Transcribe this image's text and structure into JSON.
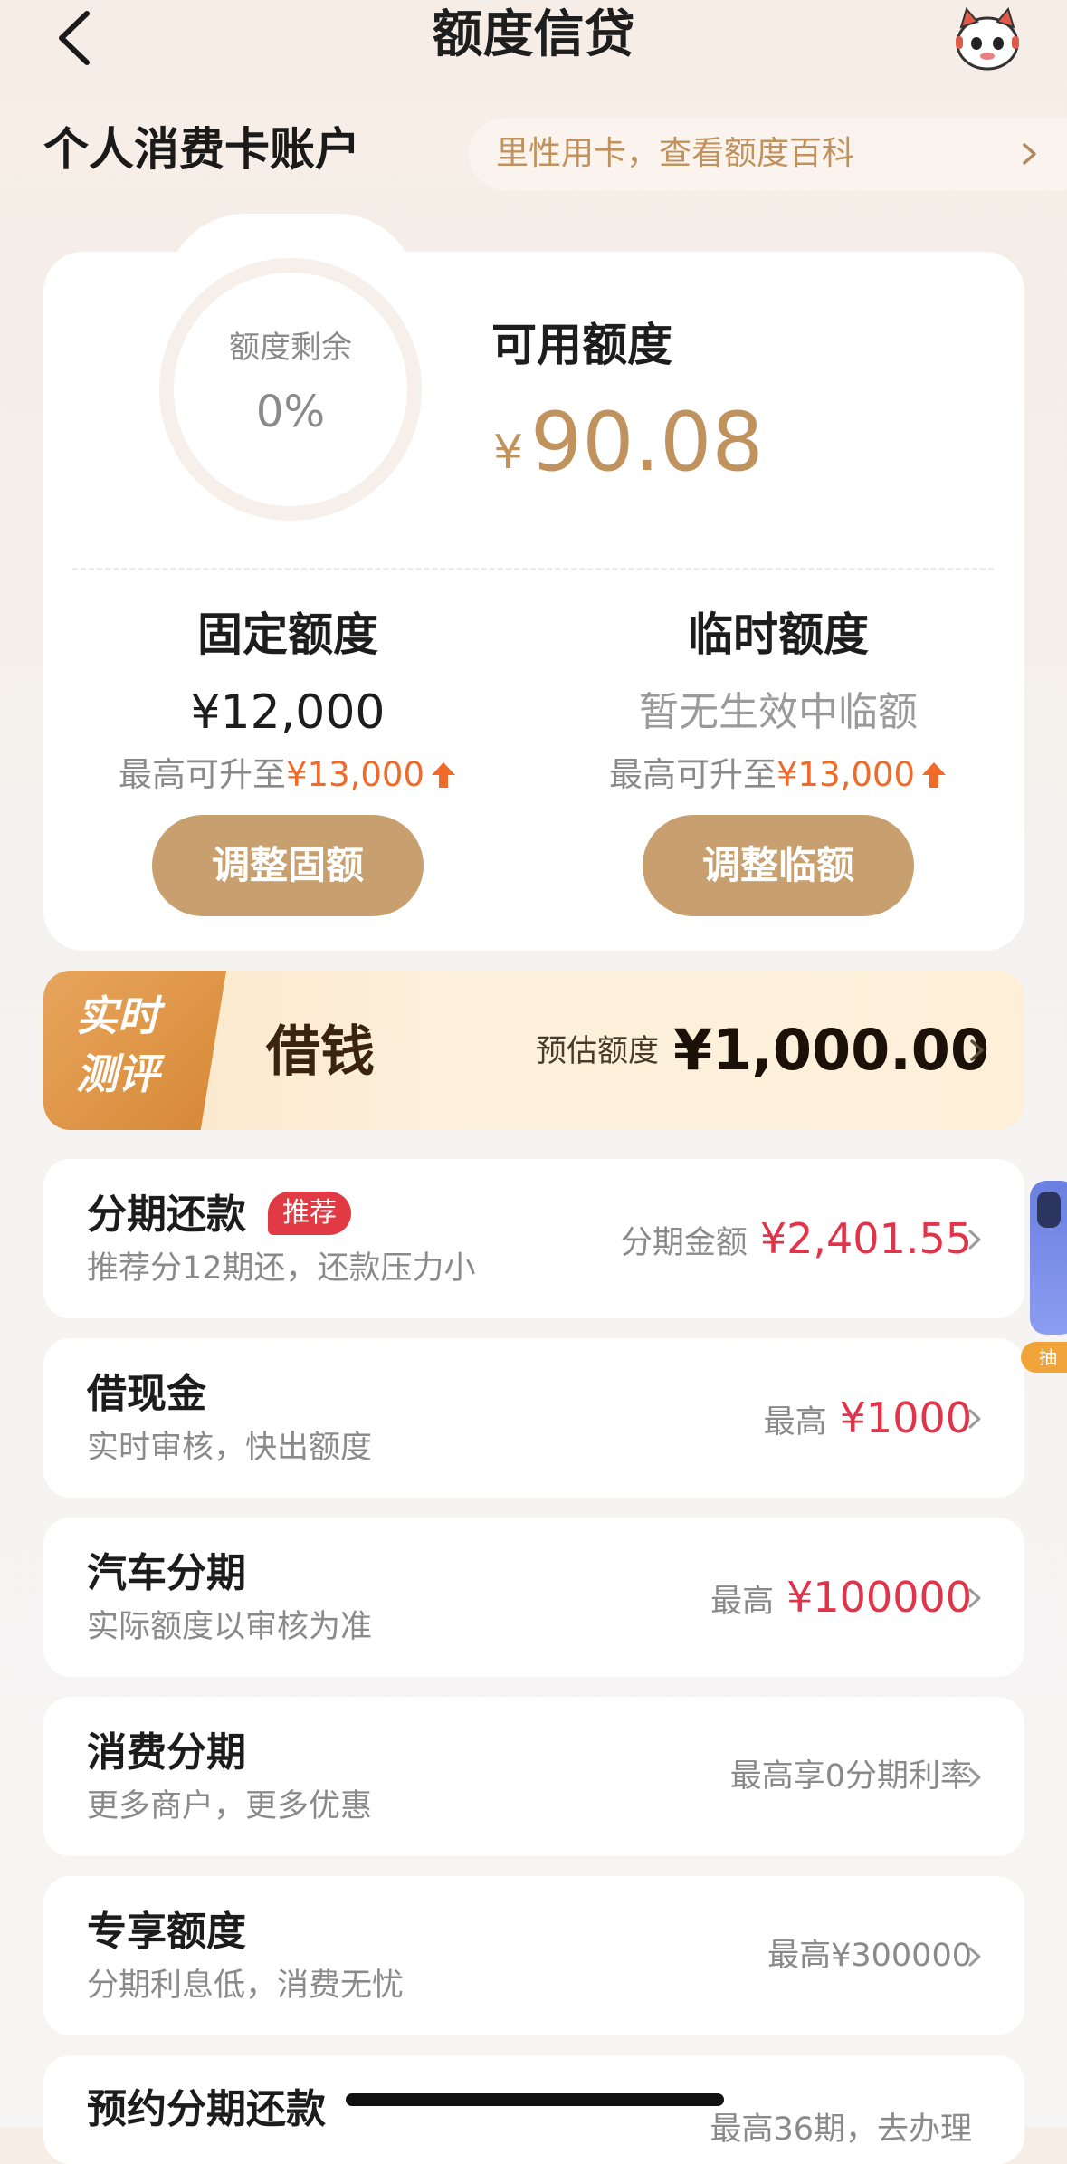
{
  "header": {
    "title": "额度信贷"
  },
  "account": {
    "title": "个人消费卡账户",
    "tip": "里性用卡，查看额度百科"
  },
  "summary": {
    "ring_label": "额度剩余",
    "ring_value": "0%",
    "ring_fraction": 0.0,
    "available_label": "可用额度",
    "available_currency": "¥",
    "available_amount": "90.08",
    "fixed": {
      "title": "固定额度",
      "value": "¥12,000",
      "sub_prefix": "最高可升至",
      "sub_amount": "¥13,000",
      "button": "调整固额"
    },
    "temporary": {
      "title": "临时额度",
      "value": "暂无生效中临额",
      "sub_prefix": "最高可升至",
      "sub_amount": "¥13,000",
      "button": "调整临额"
    }
  },
  "borrow_banner": {
    "badge_line1": "实时",
    "badge_line2": "测评",
    "label": "借钱",
    "estimate_label": "预估额度",
    "estimate_amount": "¥1,000.00"
  },
  "list": [
    {
      "title": "分期还款",
      "tag": "推荐",
      "subtitle": "推荐分12期还，还款压力小",
      "right_label": "分期金额",
      "right_amount": "¥2,401.55"
    },
    {
      "title": "借现金",
      "subtitle": "实时审核，快出额度",
      "right_label": "最高",
      "right_amount": "¥1000"
    },
    {
      "title": "汽车分期",
      "subtitle": "实际额度以审核为准",
      "right_label": "最高",
      "right_amount": "¥100000"
    },
    {
      "title": "消费分期",
      "subtitle": "更多商户，更多优惠",
      "right_label": "最高享0分期利率"
    },
    {
      "title": "专享额度",
      "subtitle": "分期利息低，消费无忧",
      "right_label": "最高¥300000"
    },
    {
      "title": "预约分期还款",
      "right_label": "最高36期，去办理"
    }
  ],
  "floating": {
    "tag": "抽"
  },
  "colors": {
    "accent_gold": "#c0925d",
    "button_gold": "#c8a070",
    "amount_red": "#e0344a",
    "rise_orange": "#f06a2a"
  }
}
